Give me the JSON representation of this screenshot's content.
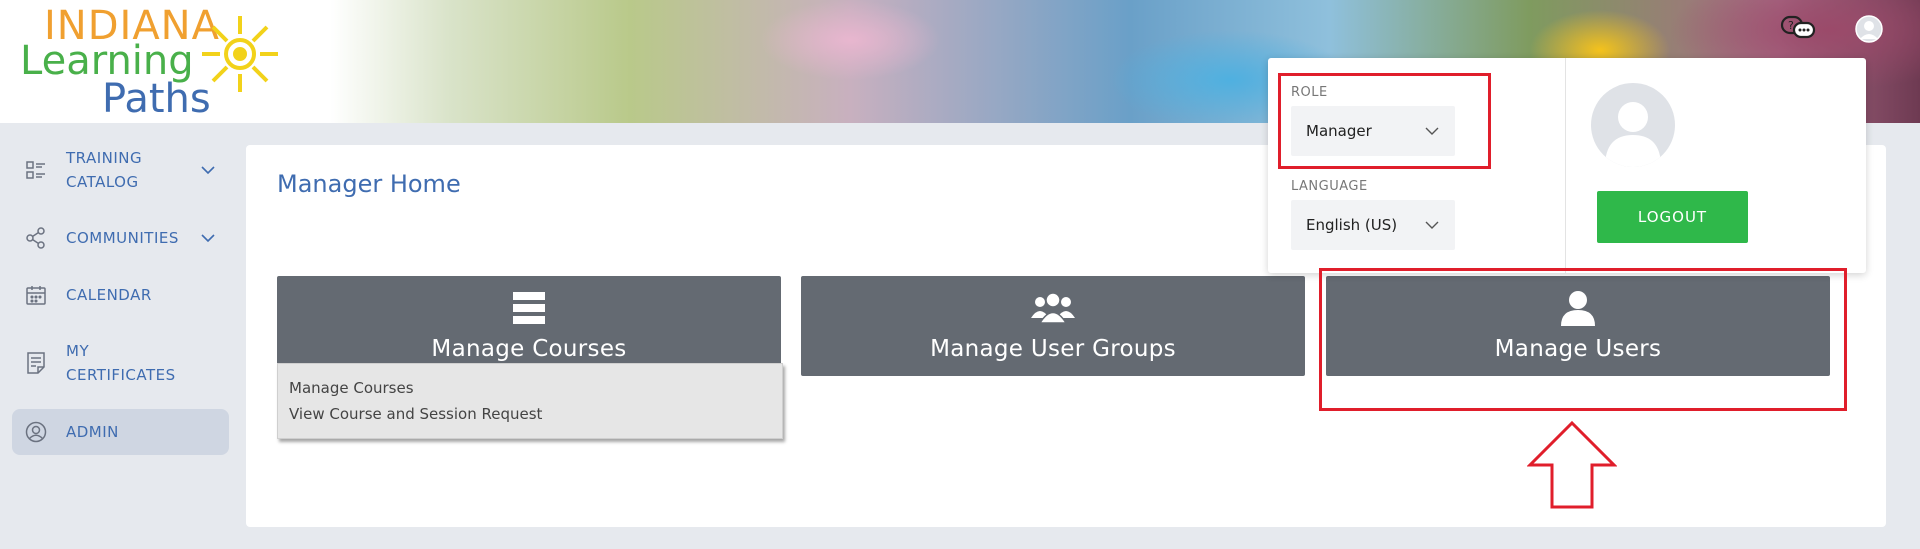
{
  "logo": {
    "line1": "INDIANA",
    "line2": "Learning",
    "line3": "Paths"
  },
  "header": {
    "help_icon": "chat-help-icon",
    "avatar_icon": "user-avatar-icon"
  },
  "sidebar": {
    "items": [
      {
        "label_line1": "TRAINING",
        "label_line2": "CATALOG",
        "icon": "catalog-icon",
        "has_chevron": true
      },
      {
        "label": "COMMUNITIES",
        "icon": "share-nodes-icon",
        "has_chevron": true
      },
      {
        "label": "CALENDAR",
        "icon": "calendar-icon",
        "has_chevron": false
      },
      {
        "label_line1": "MY",
        "label_line2": "CERTIFICATES",
        "icon": "certificate-icon",
        "has_chevron": false
      },
      {
        "label": "ADMIN",
        "icon": "user-circle-icon",
        "has_chevron": false,
        "active": true
      }
    ]
  },
  "main": {
    "title": "Manager Home",
    "tiles": [
      {
        "label": "Manage Courses",
        "icon": "list-icon"
      },
      {
        "label": "Manage User Groups",
        "icon": "users-group-icon"
      },
      {
        "label": "Manage Users",
        "icon": "user-icon"
      }
    ],
    "courses_menu": [
      "Manage Courses",
      "View Course and Session Request"
    ]
  },
  "popover": {
    "role_label": "ROLE",
    "role_value": "Manager",
    "language_label": "LANGUAGE",
    "language_value": "English (US)",
    "logout_label": "LOGOUT"
  },
  "colors": {
    "accent_blue": "#3f6cb0",
    "tile_gray": "#646a72",
    "logout_green": "#2fb84a",
    "highlight_red": "#e01e2b"
  }
}
